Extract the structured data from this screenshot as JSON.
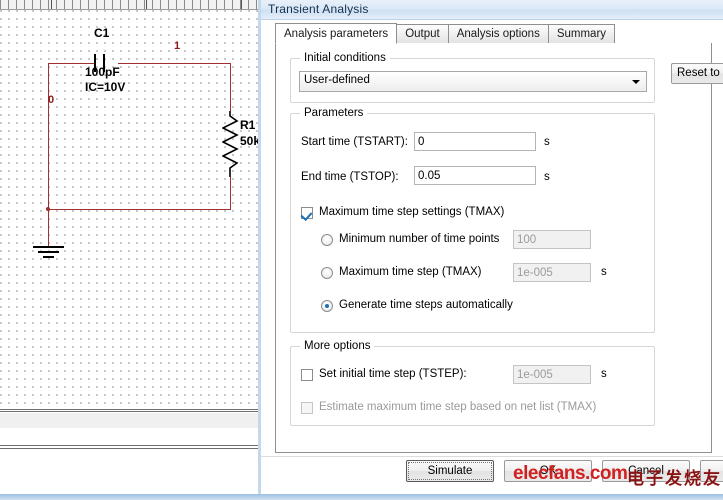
{
  "schematic": {
    "node_label_left": "0",
    "node_label_right": "1",
    "capacitor": {
      "ref": "C1",
      "value": "100pF",
      "ic": "IC=10V"
    },
    "resistor": {
      "ref": "R1",
      "value": "50k"
    }
  },
  "dialog": {
    "title": "Transient Analysis",
    "tabs": [
      {
        "label": "Analysis parameters",
        "active": true
      },
      {
        "label": "Output",
        "active": false
      },
      {
        "label": "Analysis options",
        "active": false
      },
      {
        "label": "Summary",
        "active": false
      }
    ],
    "initial_conditions": {
      "group_title": "Initial conditions",
      "selected": "User-defined",
      "options": [
        "User-defined"
      ]
    },
    "reset_button": "Reset to d",
    "parameters": {
      "group_title": "Parameters",
      "start_time_label": "Start time (TSTART):",
      "start_time_value": "0",
      "start_time_unit": "s",
      "end_time_label": "End time (TSTOP):",
      "end_time_value": "0.05",
      "end_time_unit": "s",
      "tmax_checkbox_label": "Maximum time step settings (TMAX)",
      "tmax_checkbox_checked": true,
      "radio_min_points_label": "Minimum number of time points",
      "radio_min_points_value": "100",
      "radio_tmax_label": "Maximum time step (TMAX)",
      "radio_tmax_value": "1e-005",
      "radio_tmax_unit": "s",
      "radio_auto_label": "Generate time steps automatically",
      "selected_radio": "auto"
    },
    "more_options": {
      "group_title": "More options",
      "tstep_label": "Set initial time step (TSTEP):",
      "tstep_value": "1e-005",
      "tstep_unit": "s",
      "tstep_checked": false,
      "estimate_label": "Estimate maximum time step based on net list (TMAX)",
      "estimate_checked": false
    },
    "footer": {
      "simulate": "Simulate",
      "ok": "OK",
      "cancel": "Cancel",
      "help": ""
    }
  },
  "watermark": {
    "latin": "elecfans.com",
    "chinese": "电子发烧友"
  },
  "colors": {
    "wire": "#a03030",
    "node_label": "#8b1a1a",
    "accent_blue": "#1f6fb5",
    "title_text": "#16314f",
    "watermark_red": "#d02020"
  }
}
